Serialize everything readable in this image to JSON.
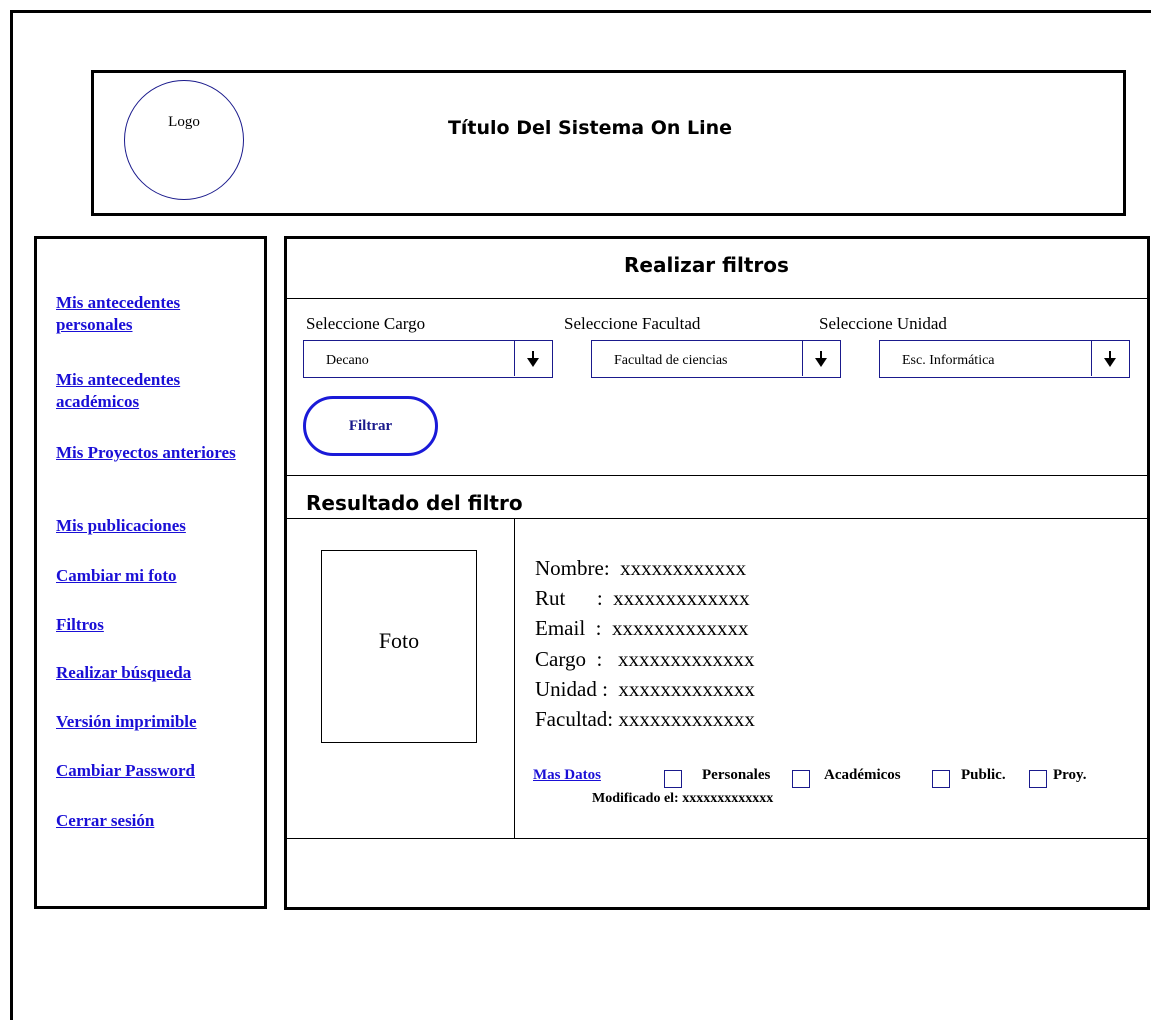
{
  "header": {
    "logo_text": "Logo",
    "title": "Título Del Sistema On Line"
  },
  "sidebar": {
    "items": [
      {
        "label": "Mis antecedentes personales"
      },
      {
        "label": "Mis antecedentes académicos"
      },
      {
        "label": "Mis Proyectos anteriores"
      },
      {
        "label": "Mis publicaciones"
      },
      {
        "label": "Cambiar mi foto"
      },
      {
        "label": "Filtros"
      },
      {
        "label": "Realizar búsqueda"
      },
      {
        "label": "Versión imprimible"
      },
      {
        "label": "Cambiar Password"
      },
      {
        "label": "Cerrar sesión"
      }
    ]
  },
  "filters": {
    "title": "Realizar filtros",
    "cargo": {
      "label": "Seleccione Cargo",
      "value": "Decano"
    },
    "facultad": {
      "label": "Seleccione Facultad",
      "value": "Facultad de ciencias"
    },
    "unidad": {
      "label": "Seleccione Unidad",
      "value": "Esc. Informática"
    },
    "button_label": "Filtrar"
  },
  "results": {
    "title": "Resultado del filtro",
    "photo_label": "Foto",
    "fields": [
      {
        "text": "Nombre:  xxxxxxxxxxxx"
      },
      {
        "text": "Rut      :  xxxxxxxxxxxxx"
      },
      {
        "text": "Email  :  xxxxxxxxxxxxx"
      },
      {
        "text": "Cargo  :   xxxxxxxxxxxxx"
      },
      {
        "text": "Unidad :  xxxxxxxxxxxxx"
      },
      {
        "text": "Facultad: xxxxxxxxxxxxx"
      }
    ],
    "more_link": "Mas Datos",
    "checkboxes": [
      {
        "label": "Personales"
      },
      {
        "label": "Académicos"
      },
      {
        "label": "Public."
      },
      {
        "label": "Proy."
      }
    ],
    "modified": "Modificado el: xxxxxxxxxxxxx"
  }
}
